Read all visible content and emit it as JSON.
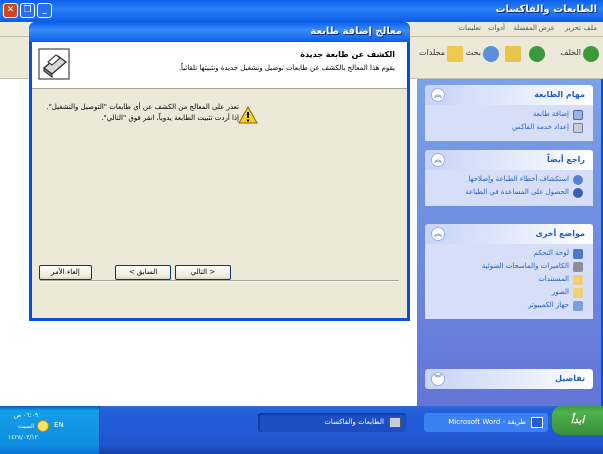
{
  "explorer": {
    "title": "الطابعات والفاكسات",
    "menu": [
      "ملف",
      "تحرير",
      "عرض",
      "المفضلة",
      "أدوات",
      "تعليمات"
    ],
    "toolbar": {
      "back": "الخلف",
      "search": "بحث",
      "folders": "مجلدات"
    }
  },
  "taskpane": {
    "printer_tasks": {
      "title": "مهام الطابعة",
      "items": [
        "إضافة طابعة",
        "إعداد خدمة الفاكس"
      ]
    },
    "see_also": {
      "title": "راجع أيضاً",
      "items": [
        "استكشاف أخطاء الطباعة وإصلاحها",
        "الحصول على المساعدة في الطباعة"
      ]
    },
    "other_places": {
      "title": "مواضع أخرى",
      "items": [
        "لوحة التحكم",
        "الكاميرات والماسحات الضوئية",
        "المستندات",
        "الصور",
        "جهاز الكمبيوتر"
      ]
    },
    "details": {
      "title": "تفاصيل"
    }
  },
  "wizard": {
    "title": "معالج إضافة طابعة",
    "header_title": "الكشف عن طابعة جديدة",
    "header_subtitle": "يقوم هذا المعالج بالكشف عن طابعات توصيل وتشغيل جديدة وتثبيتها تلقائياً.",
    "message": "تعذر على المعالج من الكشف عن أي طابعات \"التوصيل والتشغيل\". إذا أردت تثبيت الطابعة يدوياً، انقر فوق \"التالي\".",
    "buttons": {
      "back": "< السابق",
      "next": "التالي >",
      "cancel": "إلغاء الأمر"
    }
  },
  "taskbar": {
    "start": "ابدأ",
    "tasks": [
      "الطابعات والفاكسات",
      "طريقة - Microsoft Word"
    ],
    "language": "EN",
    "clock_time": "٠٦:٠٩ ص",
    "clock_day": "السبت",
    "clock_date": "١٤٢٨/٠٣/١٢"
  },
  "colors": {
    "xp_blue": "#0a5ee8",
    "start_green": "#3c9c3c",
    "link_blue": "#215dc6"
  }
}
